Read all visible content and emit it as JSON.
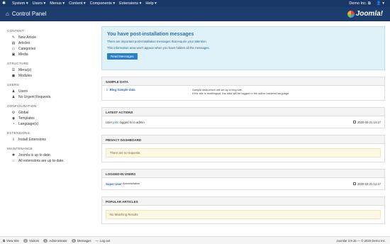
{
  "topbar": {
    "menu": [
      "System ▾",
      "Users ▾",
      "Menus ▾",
      "Content ▾",
      "Components ▾",
      "Extensions ▾",
      "Help ▾"
    ],
    "site_name": "Demo Inc. ⧉",
    "user": "👤 ▾"
  },
  "header": {
    "title": "Control Panel",
    "logo_text": "Joomla!"
  },
  "sidebar": {
    "sections": [
      {
        "title": "CONTENT",
        "items": [
          {
            "label": "New Article",
            "icon": "pencil-icon",
            "glyph": "✎"
          },
          {
            "label": "Articles",
            "icon": "articles-icon",
            "glyph": "▤"
          },
          {
            "label": "Categories",
            "icon": "folder-icon",
            "glyph": "▭"
          },
          {
            "label": "Media",
            "icon": "image-icon",
            "glyph": "▣"
          }
        ]
      },
      {
        "title": "STRUCTURE",
        "items": [
          {
            "label": "Menu(s)",
            "icon": "list-icon",
            "glyph": "☰"
          },
          {
            "label": "Modules",
            "icon": "cube-icon",
            "glyph": "◼"
          }
        ]
      },
      {
        "title": "USERS",
        "items": [
          {
            "label": "Users",
            "icon": "users-icon",
            "glyph": "♟"
          },
          {
            "label": "No Urgent Requests.",
            "icon": "user-request-icon",
            "glyph": "♟"
          }
        ]
      },
      {
        "title": "CONFIGURATION",
        "items": [
          {
            "label": "Global",
            "icon": "gear-icon",
            "glyph": "⚙"
          },
          {
            "label": "Templates",
            "icon": "eye-icon",
            "glyph": "◉"
          },
          {
            "label": "Language(s)",
            "icon": "comment-icon",
            "glyph": "◔"
          }
        ]
      },
      {
        "title": "EXTENSIONS",
        "items": [
          {
            "label": "Install Extensions",
            "icon": "download-icon",
            "glyph": "⇩"
          }
        ]
      },
      {
        "title": "MAINTENANCE",
        "items": [
          {
            "label": "Joomla is up to date.",
            "icon": "joomla-icon",
            "glyph": "✱"
          },
          {
            "label": "All extensions are up to date.",
            "icon": "star-icon",
            "glyph": "☆"
          }
        ]
      }
    ]
  },
  "alert": {
    "title": "You have post-installation messages",
    "line1": "There are important post-installation messages that require your attention.",
    "line2": "This information area won't appear when you have hidden all the messages.",
    "button": "Read Messages"
  },
  "sample_data": {
    "header": "SAMPLE DATA",
    "link": "Blog Sample data",
    "desc1": "Sample data which will set up a blog site.",
    "desc2": "If the site is multilingual, the data will be tagged to the active backend language."
  },
  "latest_actions": {
    "header": "LATEST ACTIONS",
    "prefix": "User",
    "user": "john",
    "suffix": "logged in to admin",
    "date": "2020-02-21 14:17"
  },
  "privacy": {
    "header": "PRIVACY DASHBOARD",
    "message": "There are no requests."
  },
  "logged_in": {
    "header": "LOGGED-IN USERS",
    "user": "Super User",
    "role": "Administration",
    "date": "2020-02-21 14:17"
  },
  "popular": {
    "header": "POPULAR ARTICLES",
    "message": "No Matching Results"
  },
  "footer": {
    "view_site": "View Site",
    "visitors_count": "0",
    "visitors": "Visitors",
    "admin_count": "1",
    "admin": "Administrator",
    "messages_count": "0",
    "messages": "Messages",
    "logout": "Log out",
    "version": "Joomla! 3.9.15 — © 2020 Demo Inc."
  }
}
